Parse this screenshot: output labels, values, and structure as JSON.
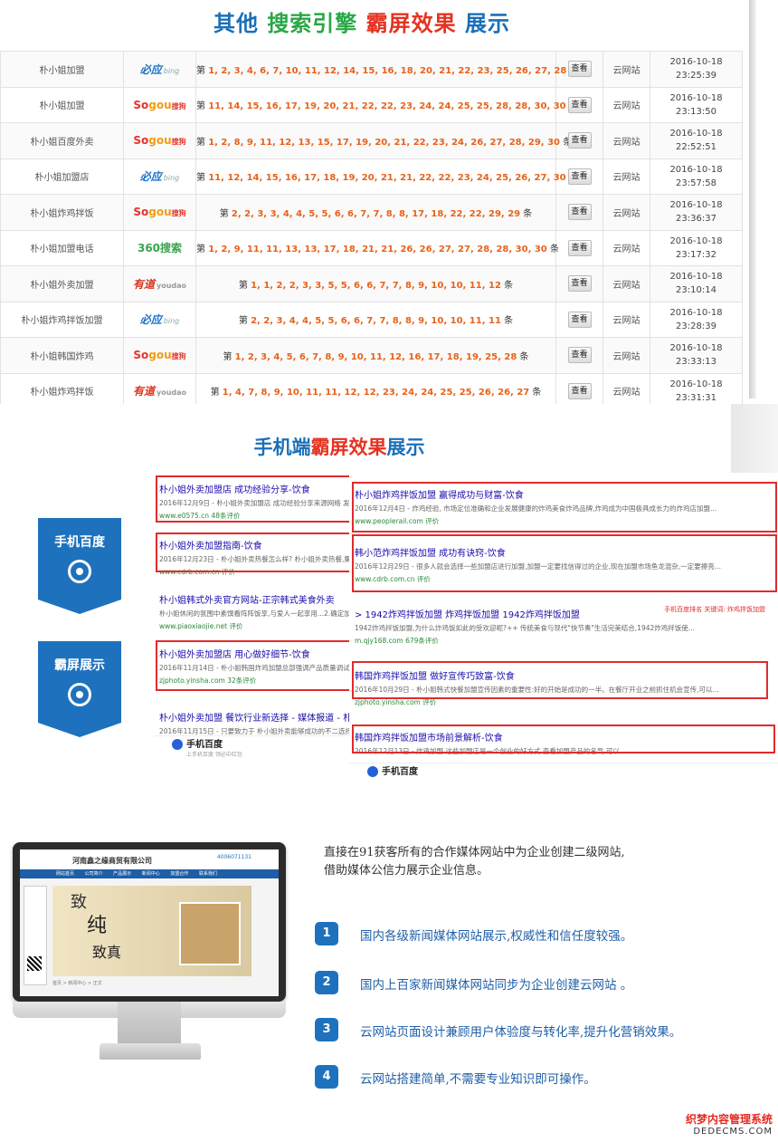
{
  "section1": {
    "title": [
      "其他 ",
      "搜索引擎",
      " 霸屏效果",
      " 展示"
    ],
    "btn": "查看",
    "rows": [
      {
        "kw": "朴小姐加盟",
        "engine": "bing",
        "pre": "第",
        "nums": "1, 2, 3, 4, 6, 7, 10, 11, 12, 14, 15, 16, 18, 20, 21, 22, 23, 25, 26, 27, 28",
        "post": "条",
        "site": "云网站",
        "date": "2016-10-18",
        "time": "23:25:39"
      },
      {
        "kw": "朴小姐加盟",
        "engine": "sogou",
        "pre": "第",
        "nums": "11, 14, 15, 16, 17, 19, 20, 21, 22, 22, 23, 24, 24, 25, 25, 28, 28, 30, 30",
        "post": "条",
        "site": "云网站",
        "date": "2016-10-18",
        "time": "23:13:50"
      },
      {
        "kw": "朴小姐百度外卖",
        "engine": "sogou",
        "pre": "第",
        "nums": "1, 2, 8, 9, 11, 12, 13, 15, 17, 19, 20, 21, 22, 23, 24, 26, 27, 28, 29, 30",
        "post": "条",
        "site": "云网站",
        "date": "2016-10-18",
        "time": "22:52:51"
      },
      {
        "kw": "朴小姐加盟店",
        "engine": "bing",
        "pre": "第",
        "nums": "11, 12, 14, 15, 16, 17, 18, 19, 20, 21, 21, 22, 22, 23, 24, 25, 26, 27, 30",
        "post": "条",
        "site": "云网站",
        "date": "2016-10-18",
        "time": "23:57:58"
      },
      {
        "kw": "朴小姐炸鸡拌饭",
        "engine": "sogou",
        "pre": "第",
        "nums": "2, 2, 3, 3, 4, 4, 5, 5, 6, 6, 7, 7, 8, 8, 17, 18, 22, 22, 29, 29",
        "post": "条",
        "site": "云网站",
        "date": "2016-10-18",
        "time": "23:36:37"
      },
      {
        "kw": "朴小姐加盟电话",
        "engine": "360",
        "pre": "第",
        "nums": "1, 2, 9, 11, 11, 13, 13, 17, 18, 21, 21, 26, 26, 27, 27, 28, 28, 30, 30",
        "post": "条",
        "site": "云网站",
        "date": "2016-10-18",
        "time": "23:17:32"
      },
      {
        "kw": "朴小姐外卖加盟",
        "engine": "youdao",
        "pre": "第",
        "nums": "1, 1, 2, 2, 3, 3, 5, 5, 6, 6, 7, 7, 8, 9, 10, 10, 11, 12",
        "post": "条",
        "site": "云网站",
        "date": "2016-10-18",
        "time": "23:10:14"
      },
      {
        "kw": "朴小姐炸鸡拌饭加盟",
        "engine": "bing",
        "pre": "第",
        "nums": "2, 2, 3, 4, 4, 5, 5, 6, 6, 7, 7, 8, 8, 9, 10, 10, 11, 11",
        "post": "条",
        "site": "云网站",
        "date": "2016-10-18",
        "time": "23:28:39"
      },
      {
        "kw": "朴小姐韩国炸鸡",
        "engine": "sogou",
        "pre": "第",
        "nums": "1, 2, 3, 4, 5, 6, 7, 8, 9, 10, 11, 12, 16, 17, 18, 19, 25, 28",
        "post": "条",
        "site": "云网站",
        "date": "2016-10-18",
        "time": "23:33:13"
      },
      {
        "kw": "朴小姐炸鸡拌饭",
        "engine": "youdao",
        "pre": "第",
        "nums": "1, 4, 7, 8, 9, 10, 11, 11, 12, 12, 23, 24, 24, 25, 25, 26, 26, 27",
        "post": "条",
        "site": "云网站",
        "date": "2016-10-18",
        "time": "23:31:31"
      }
    ],
    "engines": {
      "bing": [
        "必应",
        "bing"
      ],
      "sogou": [
        "So",
        "gou",
        "搜狗"
      ],
      "360": [
        "360搜索"
      ],
      "youdao": [
        "有道",
        "youdao"
      ]
    }
  },
  "section2": {
    "title": [
      "手机端",
      "霸屏效果",
      "展示"
    ],
    "badge1": "手机百度",
    "badge2": "霸屏展示",
    "left_results": [
      {
        "h": "朴小姐外卖加盟店 成功经验分享-饮食",
        "d": "2016年12月9日 - 朴小姐外卖加盟店 成功经验分享来源网络 发布时",
        "u": "www.e0575.cn  48条评价"
      },
      {
        "h": "朴小姐外卖加盟指南-饮食",
        "d": "2016年12月23日 - 朴小姐外卖热餐怎么样? 朴小姐外卖热餐,集美味",
        "u": "www.cdrb.com.cn  评价"
      },
      {
        "h": "朴小姐韩式外卖官方网站-正宗韩式美食外卖",
        "d": "朴小姐休闲的氛围中素馔看阵阵饭享,与爱人一起享用...2.确定加盟",
        "u": "www.piaoxiaojie.net  评价"
      },
      {
        "h": "朴小姐外卖加盟店 用心做好细节-饮食",
        "d": "2016年11月14日 - 朴小姐韩国炸鸡加盟总部强调产品质量调试,团队",
        "u": "zjphoto.yinsha.com  32条评价"
      },
      {
        "h": "朴小姐外卖加盟 餐饮行业新选择 - 媒体报道 - 朴小姐",
        "d": "2016年11月15日 - 只要致力于 朴小姐外卖能够成功的不二选择,在",
        "u": ""
      }
    ],
    "right_results": [
      {
        "h": "朴小姐炸鸡拌饭加盟 赢得成功与财富-饮食",
        "d": "2016年12月4日 - 炸鸡经验, 市场定位准确和企业发展健康的炸鸡美食炸鸡品牌,炸鸡成为中国极具成长力的炸鸡店加盟...",
        "u": "www.peoplerail.com  评价"
      },
      {
        "h": "韩小范炸鸡拌饭加盟 成功有诀窍-饮食",
        "d": "2016年12月29日 - 很多人就会选择一些加盟店进行加盟,加盟一定要找信得过的企业,现在加盟市场鱼龙混杂,一定要擦亮...",
        "u": "www.cdrb.com.cn  评价"
      },
      {
        "h": "> 1942炸鸡拌饭加盟 炸鸡拌饭加盟 1942炸鸡拌饭加盟",
        "d": "1942炸鸡拌饭加盟,为什么炸鸡饭如此的受欢迎呢?++ 传统美食与现代\"快节奏\"生活完美结合,1942炸鸡拌饭使...",
        "u": "m.qjy168.com  679条评价"
      },
      {
        "h": "韩国炸鸡拌饭加盟 做好宣传巧致富-饮食",
        "d": "2016年10月29日 - 朴小姐韩式快餐加盟宣传因素的重要性:好的开始是成功的一半。在餐厅开业之前抓住机会宣传,可以...",
        "u": "zjphoto.yinsha.com  评价"
      },
      {
        "h": "韩国炸鸡拌饭加盟市场前景解析-饮食",
        "d": "2016年12月13日 - 炸鸡加盟 这些加盟店是一个创业的好方式 查看加盟产品的名气 可以",
        "u": ""
      }
    ],
    "right_note": "手机百度排名 关键词: 炸鸡拌饭加盟",
    "bd_name": "手机百度",
    "bd_sub": "上手机百度 领必中红包"
  },
  "section3": {
    "screen_company": "河南鑫之缘商贸有限公司",
    "screen_phone": "4006071131",
    "screen_nav": "网站首页 公司简介 产品展示 新闻中心 加盟合作 联系我们",
    "screen_big": [
      "致",
      "纯",
      "致真"
    ],
    "screen_foot": "首页 > 新闻中心 > 正文",
    "intro": [
      "直接在91获客所有的合作媒体网站中为企业创建二级网站,",
      "借助媒体公信力展示企业信息。"
    ],
    "features": [
      {
        "n": "1",
        "t": "国内各级新闻媒体网站展示,权威性和信任度较强。"
      },
      {
        "n": "2",
        "t": "国内上百家新闻媒体网站同步为企业创建云网站 。"
      },
      {
        "n": "3",
        "t": "云网站页面设计兼顾用户体验度与转化率,提升化营销效果。"
      },
      {
        "n": "4",
        "t": "云网站搭建简单,不需要专业知识即可操作。"
      }
    ]
  },
  "watermark": {
    "a": "织梦内容管理系统",
    "b": "DEDECMS.COM"
  }
}
